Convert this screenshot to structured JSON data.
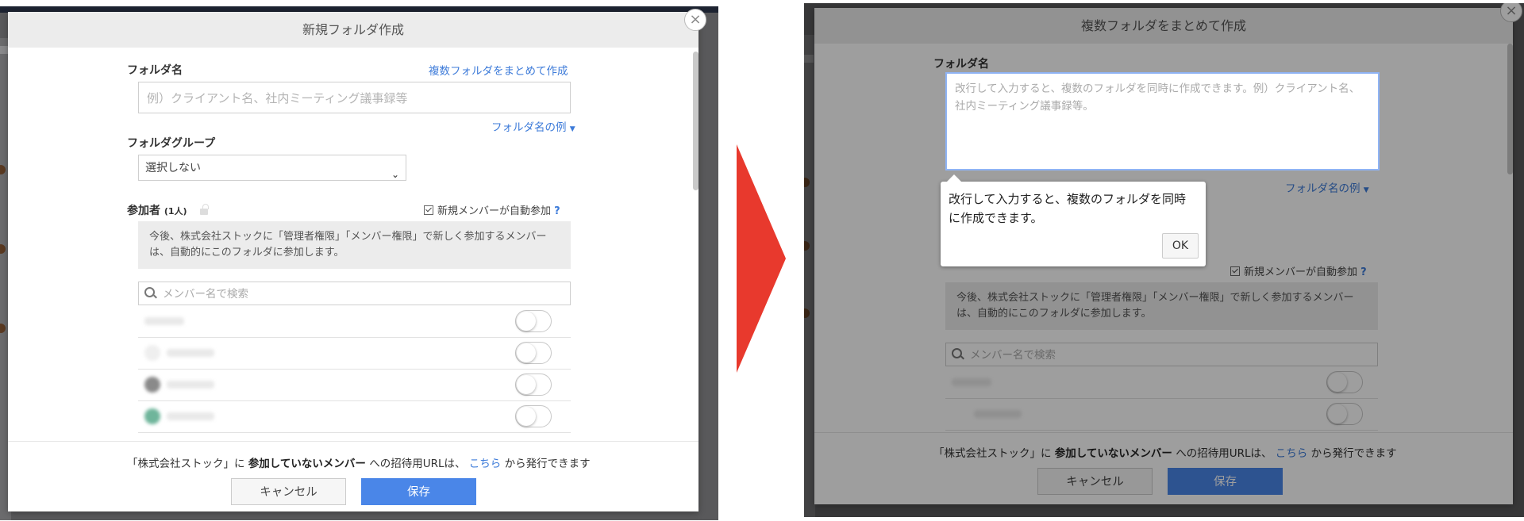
{
  "colors": {
    "accent": "#4a86e8",
    "link": "#3d7bd9",
    "arrow": "#e8392d"
  },
  "left": {
    "title": "新規フォルダ作成",
    "close_icon": "×",
    "folder_name_label": "フォルダ名",
    "bulk_create_link": "複数フォルダをまとめて作成",
    "folder_name_placeholder": "例）クライアント名、社内ミーティング議事録等",
    "examples_link": "フォルダ名の例",
    "group_label": "フォルダグループ",
    "group_selected": "選択しない",
    "participants_label": "参加者",
    "participants_count": "(1人)",
    "auto_join_label": "新規メンバーが自動参加",
    "help_icon": "?",
    "notice": "今後、株式会社ストックに「管理者権限」「メンバー権限」で新しく参加するメンバーは、自動的にこのフォルダに参加します。",
    "search_placeholder": "メンバー名で検索",
    "footer_prefix": "「株式会社ストック」に",
    "footer_bold": "参加していないメンバー",
    "footer_mid": "への招待用URLは、",
    "footer_link": "こちら",
    "footer_suffix": "から発行できます",
    "cancel": "キャンセル",
    "save": "保存"
  },
  "right": {
    "title": "複数フォルダをまとめて作成",
    "close_icon": "×",
    "folder_name_label": "フォルダ名",
    "textarea_placeholder": "改行して入力すると、複数のフォルダを同時に作成できます。例）クライアント名、社内ミーティング議事録等。",
    "examples_link": "フォルダ名の例",
    "tooltip_text": "改行して入力すると、複数のフォルダを同時に作成できます。",
    "tooltip_ok": "OK",
    "auto_join_label": "新規メンバーが自動参加",
    "help_icon": "?",
    "notice": "今後、株式会社ストックに「管理者権限」「メンバー権限」で新しく参加するメンバーは、自動的にこのフォルダに参加します。",
    "search_placeholder": "メンバー名で検索",
    "footer_prefix": "「株式会社ストック」に",
    "footer_bold": "参加していないメンバー",
    "footer_mid": "への招待用URLは、",
    "footer_link": "こちら",
    "footer_suffix": "から発行できます",
    "cancel": "キャンセル",
    "save": "保存"
  }
}
